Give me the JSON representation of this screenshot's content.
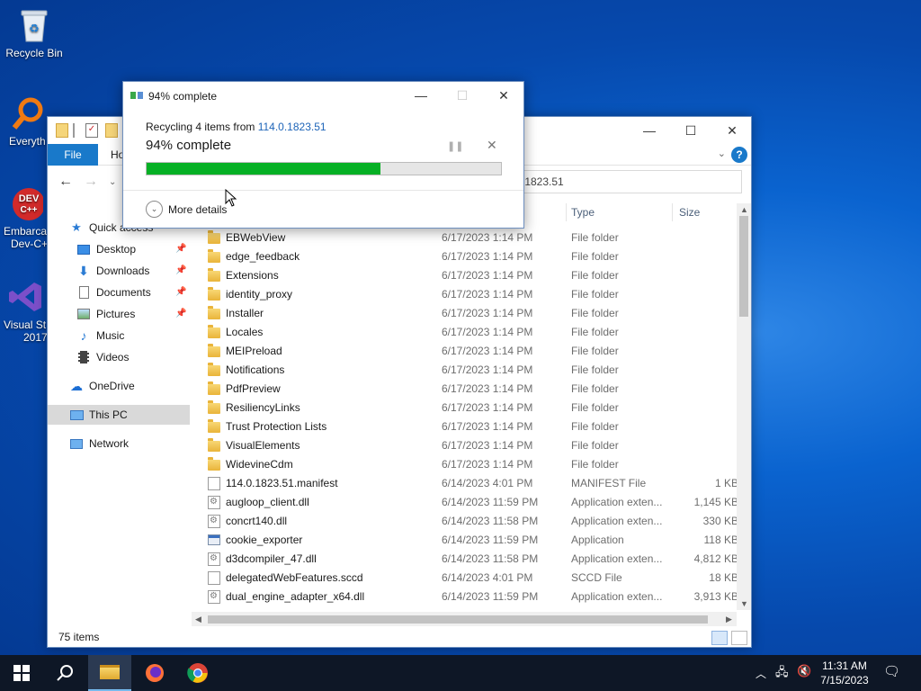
{
  "desktop": {
    "icons": [
      {
        "label": "Recycle Bin"
      },
      {
        "label": "Everyth"
      },
      {
        "label": "Embarca"
      },
      {
        "label": "Dev-C+"
      },
      {
        "label": "Visual St"
      },
      {
        "label": "2017"
      }
    ]
  },
  "explorer": {
    "tab_file": "File",
    "tab_home": "Ho",
    "address": ".1823.51",
    "columns": {
      "type": "Type",
      "size": "Size"
    },
    "sidebar": {
      "quick_access": "Quick access",
      "items": [
        {
          "label": "Desktop"
        },
        {
          "label": "Downloads"
        },
        {
          "label": "Documents"
        },
        {
          "label": "Pictures"
        },
        {
          "label": "Music"
        },
        {
          "label": "Videos"
        }
      ],
      "onedrive": "OneDrive",
      "this_pc": "This PC",
      "network": "Network"
    },
    "files": [
      {
        "name": "EBWebView",
        "date": "6/17/2023 1:14 PM",
        "type": "File folder",
        "size": "",
        "icon": "folder"
      },
      {
        "name": "edge_feedback",
        "date": "6/17/2023 1:14 PM",
        "type": "File folder",
        "size": "",
        "icon": "folder"
      },
      {
        "name": "Extensions",
        "date": "6/17/2023 1:14 PM",
        "type": "File folder",
        "size": "",
        "icon": "folder"
      },
      {
        "name": "identity_proxy",
        "date": "6/17/2023 1:14 PM",
        "type": "File folder",
        "size": "",
        "icon": "folder"
      },
      {
        "name": "Installer",
        "date": "6/17/2023 1:14 PM",
        "type": "File folder",
        "size": "",
        "icon": "folder"
      },
      {
        "name": "Locales",
        "date": "6/17/2023 1:14 PM",
        "type": "File folder",
        "size": "",
        "icon": "folder"
      },
      {
        "name": "MEIPreload",
        "date": "6/17/2023 1:14 PM",
        "type": "File folder",
        "size": "",
        "icon": "folder"
      },
      {
        "name": "Notifications",
        "date": "6/17/2023 1:14 PM",
        "type": "File folder",
        "size": "",
        "icon": "folder"
      },
      {
        "name": "PdfPreview",
        "date": "6/17/2023 1:14 PM",
        "type": "File folder",
        "size": "",
        "icon": "folder"
      },
      {
        "name": "ResiliencyLinks",
        "date": "6/17/2023 1:14 PM",
        "type": "File folder",
        "size": "",
        "icon": "folder"
      },
      {
        "name": "Trust Protection Lists",
        "date": "6/17/2023 1:14 PM",
        "type": "File folder",
        "size": "",
        "icon": "folder"
      },
      {
        "name": "VisualElements",
        "date": "6/17/2023 1:14 PM",
        "type": "File folder",
        "size": "",
        "icon": "folder"
      },
      {
        "name": "WidevineCdm",
        "date": "6/17/2023 1:14 PM",
        "type": "File folder",
        "size": "",
        "icon": "folder"
      },
      {
        "name": "114.0.1823.51.manifest",
        "date": "6/14/2023 4:01 PM",
        "type": "MANIFEST File",
        "size": "1 KB",
        "icon": "doc"
      },
      {
        "name": "augloop_client.dll",
        "date": "6/14/2023 11:59 PM",
        "type": "Application exten...",
        "size": "1,145 KB",
        "icon": "dll"
      },
      {
        "name": "concrt140.dll",
        "date": "6/14/2023 11:58 PM",
        "type": "Application exten...",
        "size": "330 KB",
        "icon": "dll"
      },
      {
        "name": "cookie_exporter",
        "date": "6/14/2023 11:59 PM",
        "type": "Application",
        "size": "118 KB",
        "icon": "app"
      },
      {
        "name": "d3dcompiler_47.dll",
        "date": "6/14/2023 11:58 PM",
        "type": "Application exten...",
        "size": "4,812 KB",
        "icon": "dll"
      },
      {
        "name": "delegatedWebFeatures.sccd",
        "date": "6/14/2023 4:01 PM",
        "type": "SCCD File",
        "size": "18 KB",
        "icon": "doc"
      },
      {
        "name": "dual_engine_adapter_x64.dll",
        "date": "6/14/2023 11:59 PM",
        "type": "Application exten...",
        "size": "3,913 KB",
        "icon": "dll"
      }
    ],
    "status": "75 items"
  },
  "dialog": {
    "title": "94% complete",
    "line1_prefix": "Recycling 4 items from ",
    "line1_link": "114.0.1823.51",
    "line2": "94% complete",
    "progress": 0.66,
    "progress_color": "#06b025",
    "more_details": "More details"
  },
  "taskbar": {
    "time": "11:31 AM",
    "date": "7/15/2023"
  }
}
